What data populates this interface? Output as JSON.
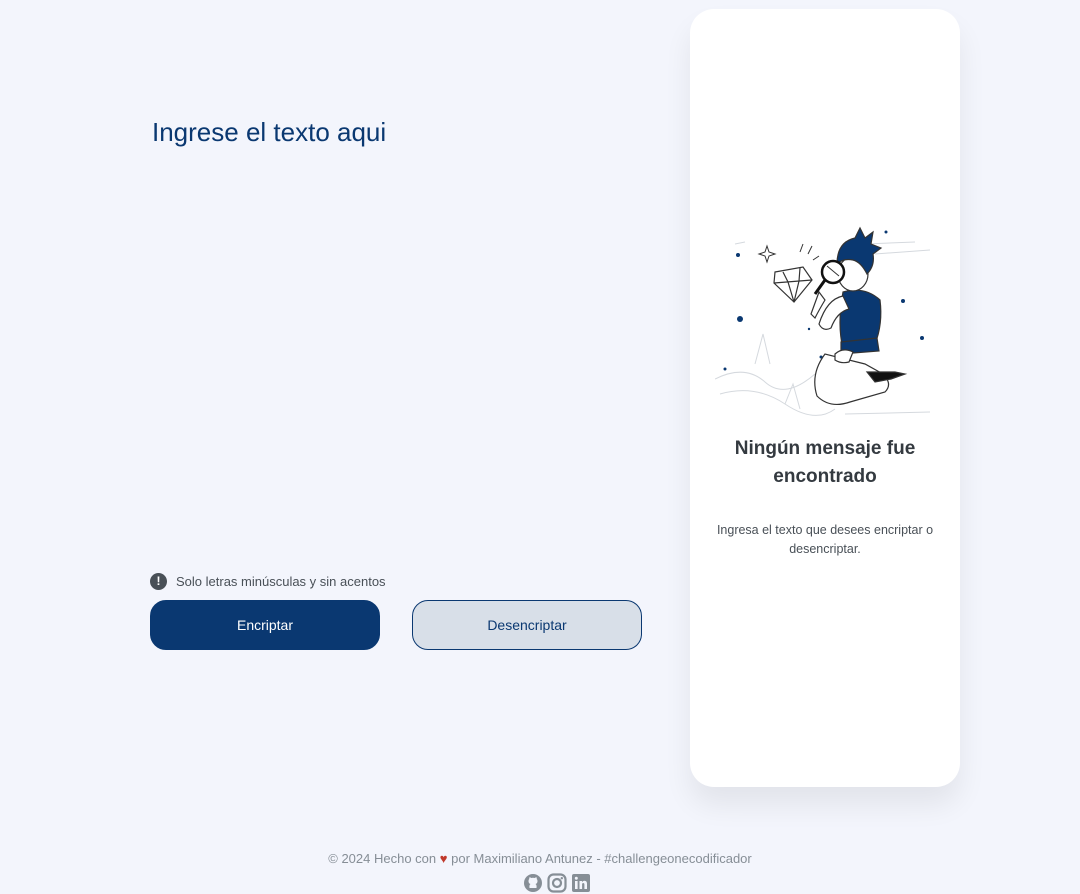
{
  "input": {
    "placeholder": "Ingrese el texto aqui",
    "value": ""
  },
  "notice": {
    "icon": "exclamation-circle-icon",
    "text": "Solo letras minúsculas y sin acentos"
  },
  "buttons": {
    "encrypt_label": "Encriptar",
    "decrypt_label": "Desencriptar"
  },
  "output": {
    "illustration": "person-with-magnifying-glass-and-diamond",
    "title": "Ningún mensaje fue encontrado",
    "description": "Ingresa el texto que desees encriptar o desencriptar."
  },
  "footer": {
    "prefix": "© 2024 Hecho con",
    "heart": "♥",
    "suffix": "por Maximiliano Antunez - #challengeonecodificador",
    "social": [
      "github-icon",
      "instagram-icon",
      "linkedin-icon"
    ]
  },
  "colors": {
    "primary": "#0a3871",
    "background": "#f3f5fc",
    "secondary_button": "#d8dfe8",
    "text_dark": "#343a40"
  }
}
